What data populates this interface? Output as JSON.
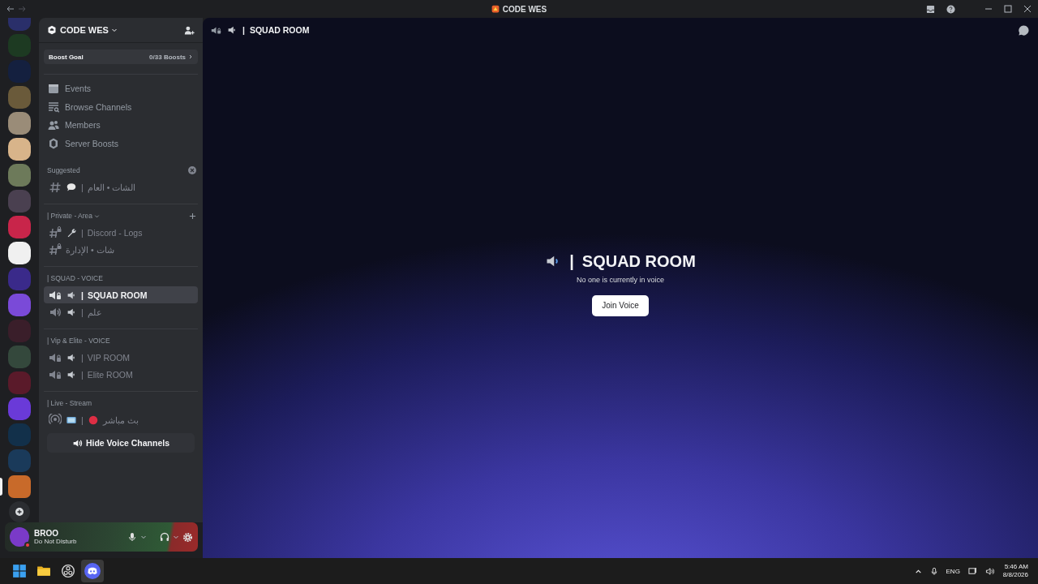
{
  "window": {
    "title": "CODE WES"
  },
  "servers": [
    {
      "color": "#2a2f6a",
      "selected": false
    },
    {
      "color": "#1d3a22",
      "selected": false
    },
    {
      "color": "#14203f",
      "selected": false
    },
    {
      "color": "#6a5a3a",
      "selected": false
    },
    {
      "color": "#9a8c78",
      "selected": false
    },
    {
      "color": "#d8b48a",
      "selected": false
    },
    {
      "color": "#6d7a5a",
      "selected": false
    },
    {
      "color": "#4a4050",
      "selected": false
    },
    {
      "color": "#c8254a",
      "selected": false
    },
    {
      "color": "#f0f0f0",
      "selected": false
    },
    {
      "color": "#3a2a8a",
      "selected": false
    },
    {
      "color": "#7a4ad8",
      "selected": false
    },
    {
      "color": "#3a1e2a",
      "selected": false
    },
    {
      "color": "#34483c",
      "selected": false
    },
    {
      "color": "#5a1a2a",
      "selected": false
    },
    {
      "color": "#6a3ad8",
      "selected": false
    },
    {
      "color": "#12304a",
      "selected": false
    },
    {
      "color": "#1a3a5a",
      "selected": false
    },
    {
      "color": "#c86a2a",
      "selected": true
    }
  ],
  "server": {
    "name": "CODE WES",
    "boost_goal": {
      "label": "Boost Goal",
      "count": "0/33 Boosts"
    },
    "nav": [
      {
        "kind": "events",
        "label": "Events"
      },
      {
        "kind": "browse",
        "label": "Browse Channels"
      },
      {
        "kind": "members",
        "label": "Members"
      },
      {
        "kind": "boosts",
        "label": "Server Boosts"
      }
    ]
  },
  "sections": [
    {
      "title": "Suggested",
      "action": {
        "kind": "dismiss"
      },
      "collapsible": false,
      "channels": [
        {
          "kind": "text",
          "emojis": [
            {
              "kind": "speech"
            }
          ],
          "separator": "|",
          "name": "الشات • العام",
          "selected": false
        }
      ]
    },
    {
      "title": "| Private - Area",
      "action": {
        "kind": "add"
      },
      "collapsible": true,
      "channels": [
        {
          "kind": "text-locked",
          "emojis": [
            {
              "kind": "wrench"
            }
          ],
          "separator": "|",
          "name": "Discord - Logs",
          "selected": false
        },
        {
          "kind": "text-locked",
          "name": "شات • الإدارة",
          "selected": false
        }
      ]
    },
    {
      "title": "| SQUAD - VOICE",
      "collapsible": false,
      "channels": [
        {
          "kind": "voice-locked",
          "emojis": [
            {
              "kind": "speaker"
            }
          ],
          "separator": "|",
          "name": "SQUAD ROOM",
          "selected": true
        },
        {
          "kind": "voice",
          "emojis": [
            {
              "kind": "speaker"
            }
          ],
          "separator": "|",
          "name": "علم",
          "selected": false
        }
      ]
    },
    {
      "title": "| Vip & Elite - VOICE",
      "collapsible": false,
      "channels": [
        {
          "kind": "voice-locked",
          "emojis": [
            {
              "kind": "speaker"
            }
          ],
          "separator": "|",
          "name": "VIP ROOM",
          "selected": false
        },
        {
          "kind": "voice-locked",
          "emojis": [
            {
              "kind": "speaker"
            }
          ],
          "separator": "|",
          "name": "Elite ROOM",
          "selected": false
        }
      ]
    },
    {
      "title": "| Live - Stream",
      "collapsible": false,
      "channels": [
        {
          "kind": "stage",
          "emojis": [
            {
              "kind": "tv"
            }
          ],
          "separator": "|",
          "name": "بث مباشر",
          "name_emoji": {
            "kind": "red-circle"
          },
          "selected": false
        }
      ]
    }
  ],
  "hide_voice_button": "Hide Voice Channels",
  "user": {
    "name": "BROO",
    "status": "Do Not Disturb"
  },
  "header": {
    "separator": "|",
    "channel": "SQUAD ROOM"
  },
  "voice_stage": {
    "separator": "|",
    "channel": "SQUAD ROOM",
    "message": "No one is currently in voice",
    "button": "Join Voice"
  },
  "taskbar": {
    "apps": [
      {
        "kind": "start",
        "selected": false
      },
      {
        "kind": "folder",
        "selected": false
      },
      {
        "kind": "obs",
        "selected": false
      },
      {
        "kind": "discord",
        "selected": true
      }
    ],
    "language": "ENG",
    "time": "5:46 AM",
    "date": "8/8/2026"
  }
}
